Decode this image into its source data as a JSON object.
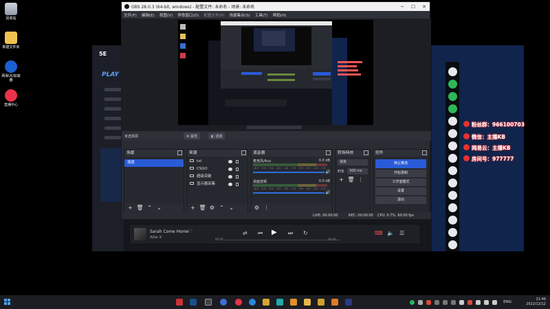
{
  "desktop": {
    "icons": [
      {
        "label": "回收站"
      },
      {
        "label": "新建文件夹"
      },
      {
        "label": "网易UU加速器"
      },
      {
        "label": "直播中心"
      }
    ]
  },
  "obs": {
    "title": "OBS 28.0.3 (64-bit, windows) - 配置文件: 未命名 - 场景: 未命名",
    "menu": [
      "文件(F)",
      "编辑(E)",
      "视图(V)",
      "停靠窗口(D)",
      "配置文件(P)",
      "场景集合(S)",
      "工具(T)",
      "帮助(H)"
    ],
    "preview_bar": {
      "source_label": "未选择源",
      "properties": "属性",
      "filters": "滤镜"
    },
    "scenes": {
      "header": "场景",
      "items": [
        "场景"
      ]
    },
    "sources": {
      "header": "来源",
      "items": [
        {
          "label": "txt",
          "icon": "text-icon"
        },
        {
          "label": "CSGO",
          "icon": "game-icon"
        },
        {
          "label": "超级突破",
          "icon": "image-icon"
        },
        {
          "label": "显示器采集",
          "icon": "monitor-icon"
        }
      ]
    },
    "mixer": {
      "header": "混音器",
      "channels": [
        {
          "name": "麦克风/Aux",
          "db": "0.0 dB"
        },
        {
          "name": "桌面音频",
          "db": "0.0 dB"
        }
      ],
      "scale": "-60 -55 -50 -45 -40 -35 -30 -25 -20 -15 -10 -5 0"
    },
    "transitions": {
      "header": "转场特效",
      "selected": "渐变",
      "duration_label": "时长",
      "duration_value": "300 ms"
    },
    "controls": {
      "header": "控件",
      "buttons": [
        "停止推流",
        "开始录制",
        "工作室模式",
        "设置",
        "退出"
      ]
    },
    "status": {
      "live": "LIVE: 00:00:00",
      "rec": "REC: 00:00:00",
      "cpu": "CPU: 0.7%, 60.00 fps"
    }
  },
  "music": {
    "title": "Sarah Come Home",
    "artist": "Allie X",
    "time_start": "00:00",
    "time_end": "00:00"
  },
  "overlay": {
    "lines": [
      {
        "text": "粉丝群：966100703"
      },
      {
        "text": "微信：主播KB"
      },
      {
        "text": "网易云：主播KB"
      },
      {
        "text": "房间号：977777"
      }
    ]
  },
  "bg_app": {
    "logo": "5E",
    "play": "PLAY D"
  },
  "taskbar": {
    "lang": "ENG",
    "time": "21:46",
    "date": "2022/12/12"
  }
}
